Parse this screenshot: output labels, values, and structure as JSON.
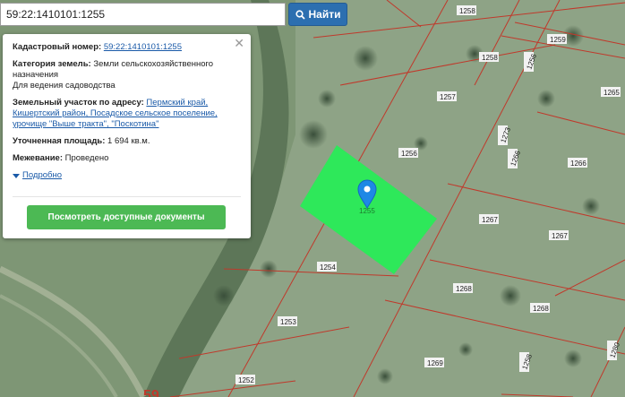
{
  "search": {
    "value": "59:22:1410101:1255",
    "button_label": "Найти",
    "icon": "search-icon"
  },
  "info": {
    "cadastral_label": "Кадастровый номер:",
    "cadastral_value": "59:22:1410101:1255",
    "category_label": "Категория земель:",
    "category_value": "Земли сельскохозяйственного назначения",
    "category_use": "Для ведения садоводства",
    "address_label": "Земельный участок по адресу:",
    "address_value": "Пермский край, Кишертский район, Посадское сельское поселение, урочище \"Выше тракта\", \"Поскотина\"",
    "area_label": "Уточненная площадь:",
    "area_value": "1 694 кв.м.",
    "survey_label": "Межевание:",
    "survey_value": "Проведено",
    "details_link": "Подробно",
    "documents_button": "Посмотреть доступные документы"
  },
  "map": {
    "parcels": [
      "1258",
      "1259",
      "1258",
      "1256",
      "1265",
      "1257",
      "1273",
      "1256",
      "1266",
      "1266",
      "1267",
      "1267",
      "1254",
      "1268",
      "1268",
      "1253",
      "1252",
      "1269",
      "1280",
      "1258",
      "1255"
    ],
    "partial_label": "59",
    "colors": {
      "boundary": "#c0392b",
      "selected": "#2ee85a",
      "marker": "#1e88e5"
    }
  }
}
